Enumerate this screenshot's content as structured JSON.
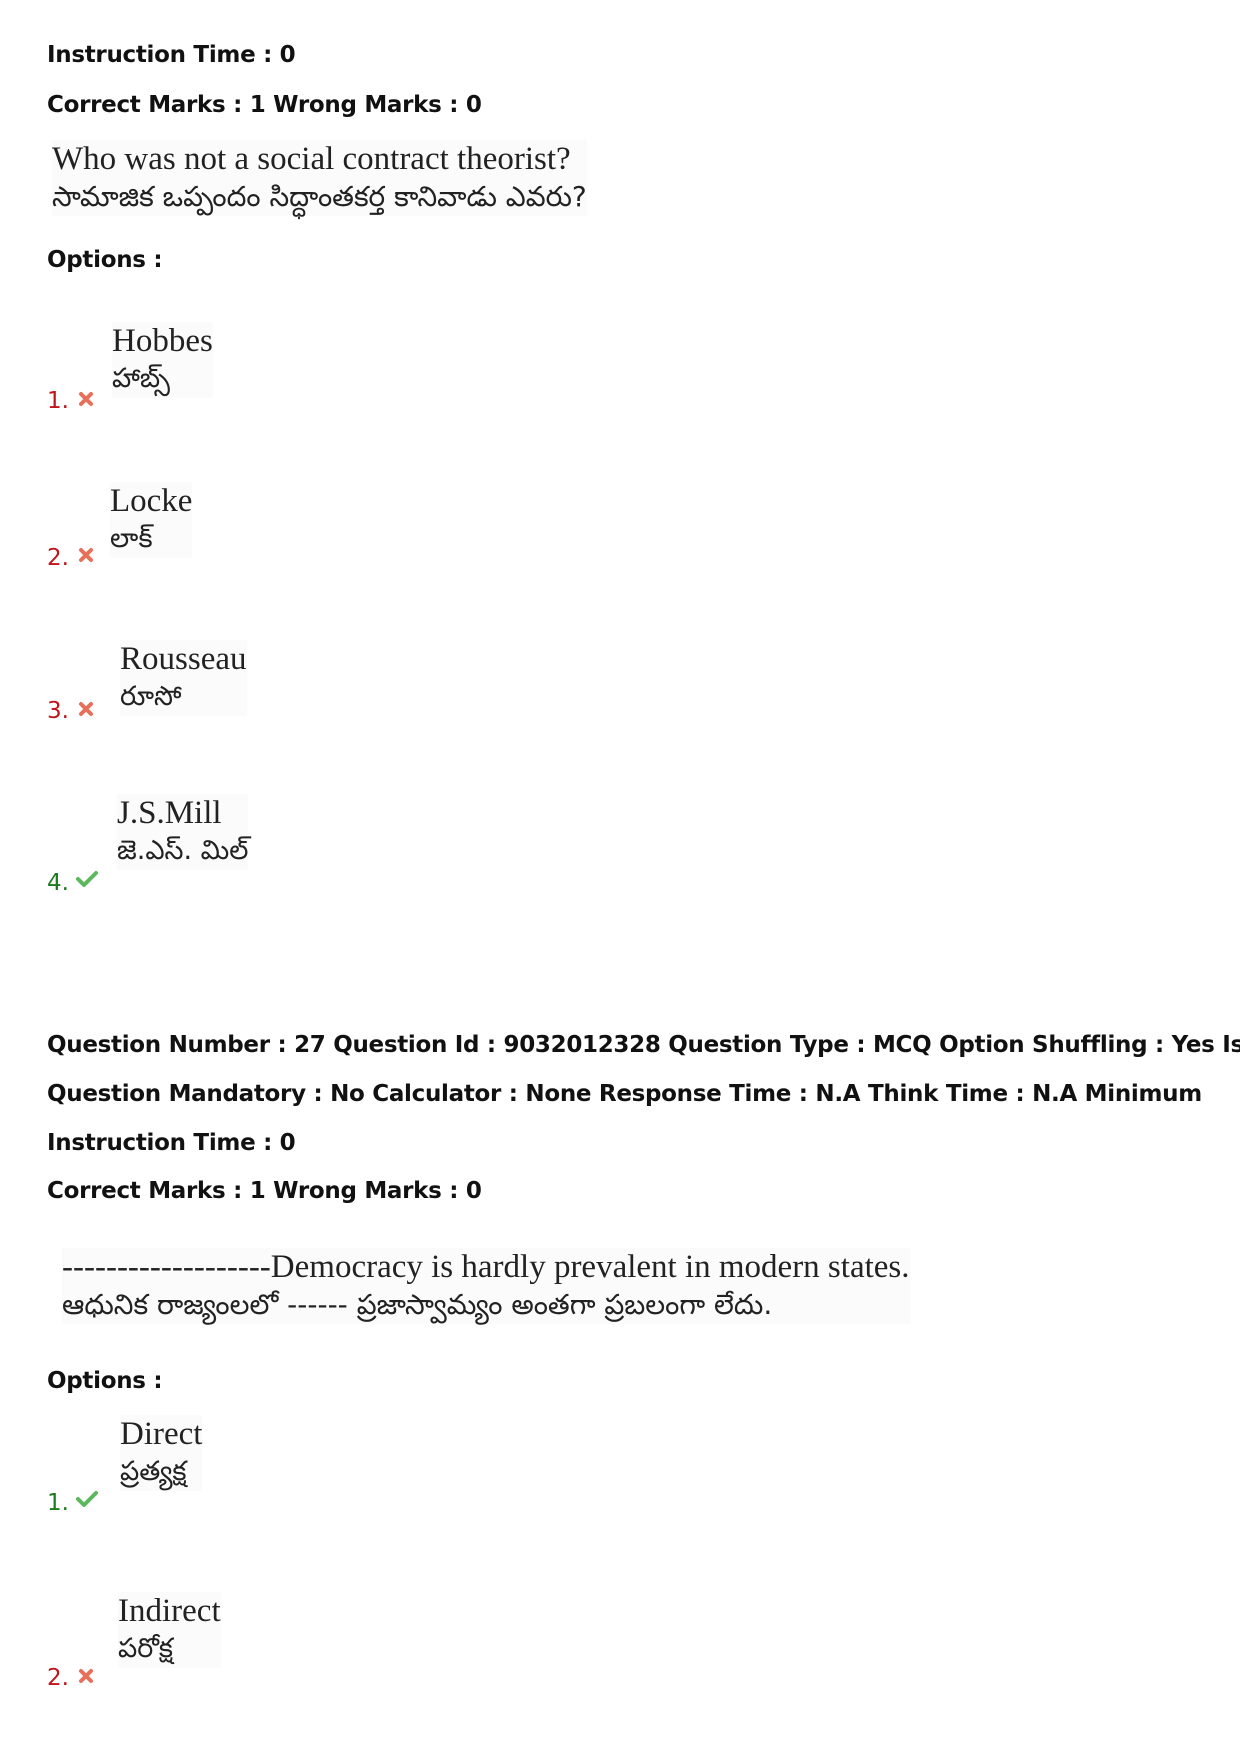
{
  "question_26_tail": {
    "instruction_time": "Instruction Time : 0",
    "marks": "Correct Marks : 1 Wrong Marks : 0",
    "question_en": "Who was not a social contract theorist?",
    "question_te": "సామాజిక ఒప్పందం సిద్ధాంతకర్త కానివాడు ఎవరు?",
    "options_label": "Options :",
    "options": [
      {
        "number": "1.",
        "status": "wrong",
        "icon": "cross-icon",
        "en": "Hobbes",
        "te": "హాబ్స్"
      },
      {
        "number": "2.",
        "status": "wrong",
        "icon": "cross-icon",
        "en": "Locke",
        "te": "లాక్"
      },
      {
        "number": "3.",
        "status": "wrong",
        "icon": "cross-icon",
        "en": "Rousseau",
        "te": "రూసో"
      },
      {
        "number": "4.",
        "status": "correct",
        "icon": "check-icon",
        "en": "J.S.Mill",
        "te": "జె.ఎస్. మిల్"
      }
    ]
  },
  "question_27": {
    "header_line1": "Question Number : 27 Question Id : 9032012328 Question Type : MCQ Option Shuffling : Yes Is",
    "header_line2": "Question Mandatory : No Calculator : None Response Time : N.A Think Time : N.A Minimum",
    "instruction_time": "Instruction Time : 0",
    "marks": "Correct Marks : 1 Wrong Marks : 0",
    "question_en": "-------------------Democracy is hardly prevalent in modern states.",
    "question_te": "ఆధునిక రాజ్యంలలో ------ ప్రజాస్వామ్యం అంతగా ప్రబలంగా లేదు.",
    "options_label": "Options :",
    "options": [
      {
        "number": "1.",
        "status": "correct",
        "icon": "check-icon",
        "en": "Direct",
        "te": "ప్రత్యక్ష"
      },
      {
        "number": "2.",
        "status": "wrong",
        "icon": "cross-icon",
        "en": "Indirect",
        "te": "పరోక్ష"
      }
    ]
  },
  "colors": {
    "wrong": "#c0141c",
    "correct": "#1e7a1e",
    "cross_icon": "#e8705a",
    "check_icon": "#5cb85c"
  }
}
